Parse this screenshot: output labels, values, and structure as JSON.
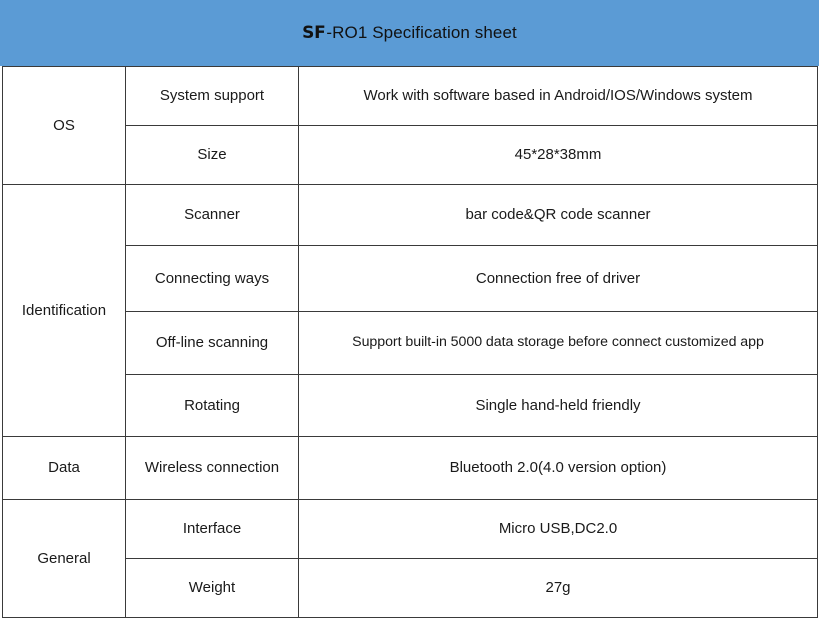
{
  "document": {
    "title_brand": "SF",
    "title_rest": "-RO1 Specification sheet",
    "title_full": "SF-RO1 Specification sheet",
    "header_color": "#5b9bd5",
    "border_color": "#3a3a3a",
    "text_color": "#1a1a1a"
  },
  "table": {
    "groups": [
      {
        "name": "OS",
        "rows": [
          {
            "item": "System support",
            "value": "Work with software based in Android/IOS/Windows system"
          },
          {
            "item": "Size",
            "value": "45*28*38mm"
          }
        ]
      },
      {
        "name": "Identification",
        "rows": [
          {
            "item": "Scanner",
            "value": "bar code&QR code scanner"
          },
          {
            "item": "Connecting ways",
            "value": "Connection free of driver"
          },
          {
            "item": "Off-line scanning",
            "value": "Support built-in 5000 data storage before connect customized app"
          },
          {
            "item": "Rotating",
            "value": "Single hand-held friendly"
          }
        ]
      },
      {
        "name": "Data",
        "rows": [
          {
            "item": "Wireless connection",
            "value": "Bluetooth 2.0(4.0 version option)"
          }
        ]
      },
      {
        "name": "General",
        "rows": [
          {
            "item": "Interface",
            "value": "Micro USB,DC2.0"
          },
          {
            "item": "Weight",
            "value": "27g"
          }
        ]
      }
    ]
  }
}
